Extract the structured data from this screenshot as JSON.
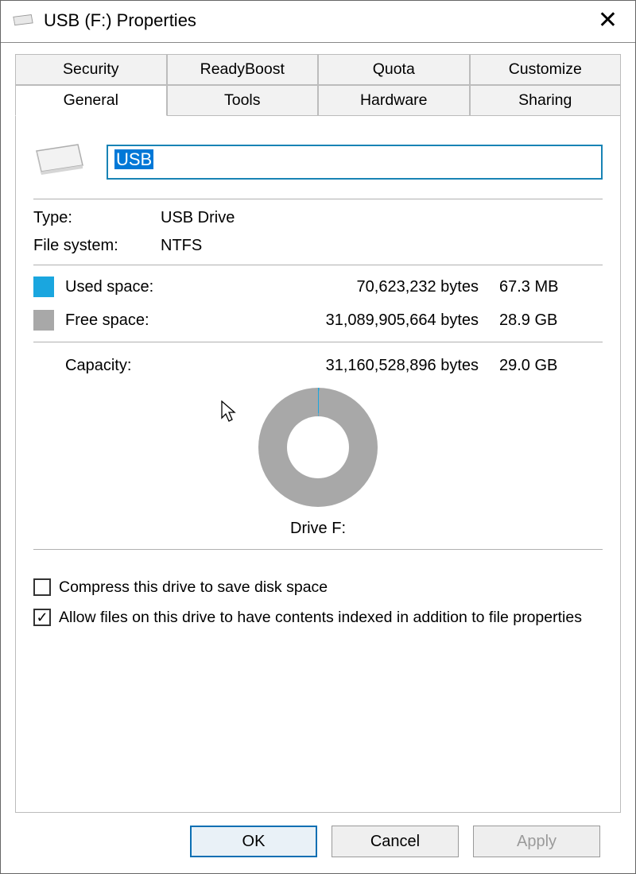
{
  "window": {
    "title": "USB (F:) Properties"
  },
  "tabs": {
    "row1": [
      "Security",
      "ReadyBoost",
      "Quota",
      "Customize"
    ],
    "row2": [
      "General",
      "Tools",
      "Hardware",
      "Sharing"
    ],
    "active": "General"
  },
  "drive": {
    "name_value": "USB",
    "type_label": "Type:",
    "type_value": "USB Drive",
    "fs_label": "File system:",
    "fs_value": "NTFS",
    "used_label": "Used space:",
    "used_bytes": "70,623,232 bytes",
    "used_human": "67.3 MB",
    "free_label": "Free space:",
    "free_bytes": "31,089,905,664 bytes",
    "free_human": "28.9 GB",
    "capacity_label": "Capacity:",
    "capacity_bytes": "31,160,528,896 bytes",
    "capacity_human": "29.0 GB",
    "pie_label": "Drive F:"
  },
  "options": {
    "compress_label": "Compress this drive to save disk space",
    "compress_checked": false,
    "index_label": "Allow files on this drive to have contents indexed in addition to file properties",
    "index_checked": true
  },
  "buttons": {
    "ok": "OK",
    "cancel": "Cancel",
    "apply": "Apply"
  },
  "colors": {
    "used": "#1aa6df",
    "free": "#a8a8a8",
    "accent": "#0b6fb3"
  },
  "chart_data": {
    "type": "pie",
    "title": "Drive F:",
    "series": [
      {
        "name": "Used space",
        "value_bytes": 70623232,
        "value_human": "67.3 MB",
        "color": "#1aa6df"
      },
      {
        "name": "Free space",
        "value_bytes": 31089905664,
        "value_human": "28.9 GB",
        "color": "#a8a8a8"
      }
    ],
    "total_bytes": 31160528896,
    "total_human": "29.0 GB"
  }
}
